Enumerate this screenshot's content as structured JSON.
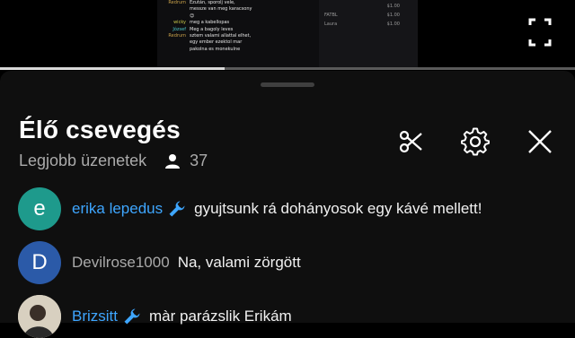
{
  "video": {
    "stream_chat": [
      {
        "user": "Redrum",
        "text": "Ezután, sporolj vele,",
        "color": "#c8a14a"
      },
      {
        "user": "",
        "text": "messze van meg karacsony",
        "color": "#c8a14a"
      },
      {
        "user": "",
        "text": "😊",
        "color": "#c8a14a"
      },
      {
        "user": "wicky",
        "text": "meg a kabellopas",
        "color": "#c8c84a"
      },
      {
        "user": "József",
        "text": "Meg a bagoly leves",
        "color": "#4ac8c8"
      },
      {
        "user": "Redrum",
        "text": "sztem valami allattal elhet,",
        "color": "#c8a14a"
      },
      {
        "user": "",
        "text": "egy ember ezektol mar",
        "color": "#c8a14a"
      },
      {
        "user": "",
        "text": "pakolna es monekulne",
        "color": "#c8a14a"
      }
    ],
    "donations": [
      {
        "name": "",
        "amount": "$1.00"
      },
      {
        "name": "FATBL",
        "amount": "$1.00"
      },
      {
        "name": "Laura",
        "amount": "$1.00"
      }
    ],
    "progress_fraction": 0.39,
    "icon": "fullscreen-icon"
  },
  "panel": {
    "title": "Élő csevegés",
    "filter_label": "Legjobb üzenetek",
    "viewer_count": "37",
    "icons": [
      "scissors-icon",
      "gear-icon",
      "close-icon"
    ]
  },
  "messages": [
    {
      "author": "erika lepedus",
      "text": "gyujtsunk rá dohányosok egy kávé mellett!",
      "initial": "e",
      "avatar_color": "#1e9a8c",
      "author_color": "#3ea6ff",
      "moderator": true
    },
    {
      "author": "Devilrose1000",
      "text": "Na, valami zörgött",
      "initial": "D",
      "avatar_color": "#2b5aa8",
      "author_color": "#aaaaaa",
      "moderator": false
    },
    {
      "author": "Brizsitt",
      "text": "màr parázslik Erikám",
      "initial": "",
      "avatar_color": "#d8d0c0",
      "author_color": "#3ea6ff",
      "moderator": true
    }
  ]
}
